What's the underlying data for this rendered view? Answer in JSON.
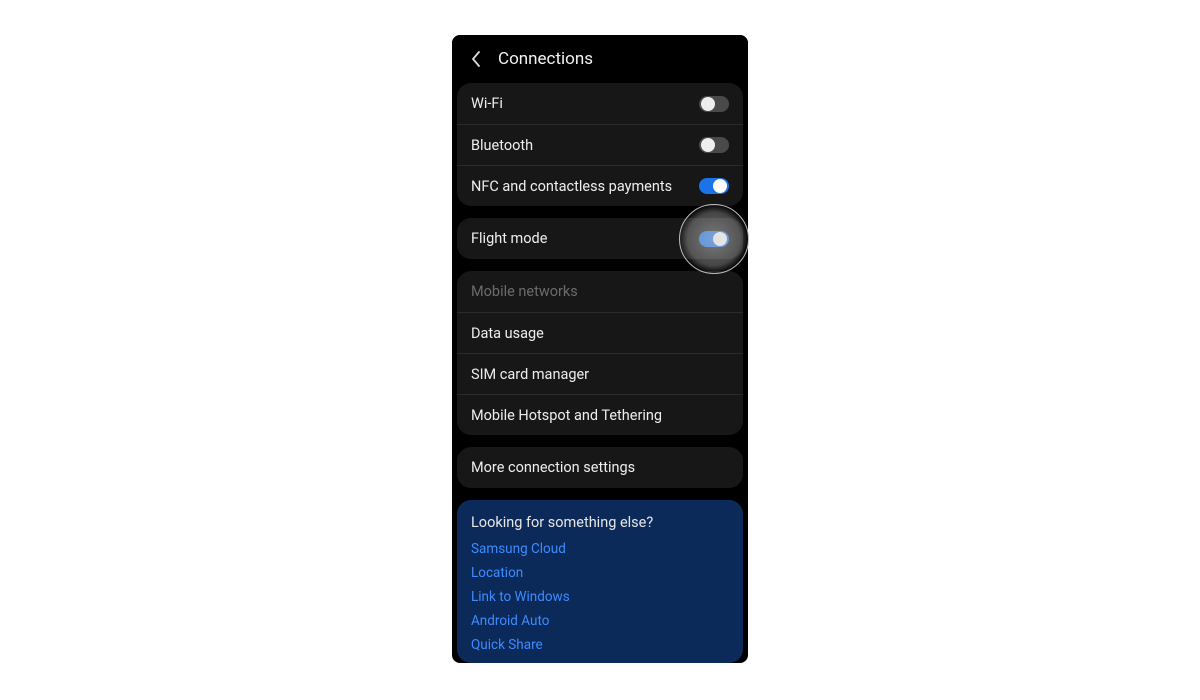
{
  "header": {
    "title": "Connections"
  },
  "groups": {
    "g1": {
      "wifi": {
        "label": "Wi-Fi",
        "on": false
      },
      "bluetooth": {
        "label": "Bluetooth",
        "on": false
      },
      "nfc": {
        "label": "NFC and contactless payments",
        "on": true
      }
    },
    "g2": {
      "flight": {
        "label": "Flight mode",
        "on": true
      }
    },
    "g3": {
      "mobile_networks": {
        "label": "Mobile networks",
        "disabled": true
      },
      "data_usage": {
        "label": "Data usage"
      },
      "sim_manager": {
        "label": "SIM card manager"
      },
      "hotspot": {
        "label": "Mobile Hotspot and Tethering"
      }
    },
    "g4": {
      "more": {
        "label": "More connection settings"
      }
    }
  },
  "suggest": {
    "title": "Looking for something else?",
    "links": {
      "samsung_cloud": "Samsung Cloud",
      "location": "Location",
      "link_to_windows": "Link to Windows",
      "android_auto": "Android Auto",
      "quick_share": "Quick Share"
    }
  },
  "colors": {
    "accent": "#1a73e8",
    "suggest_bg": "#0b2a5a",
    "link": "#3d8bff"
  },
  "touch_indicator": {
    "target": "flight-mode-toggle"
  }
}
